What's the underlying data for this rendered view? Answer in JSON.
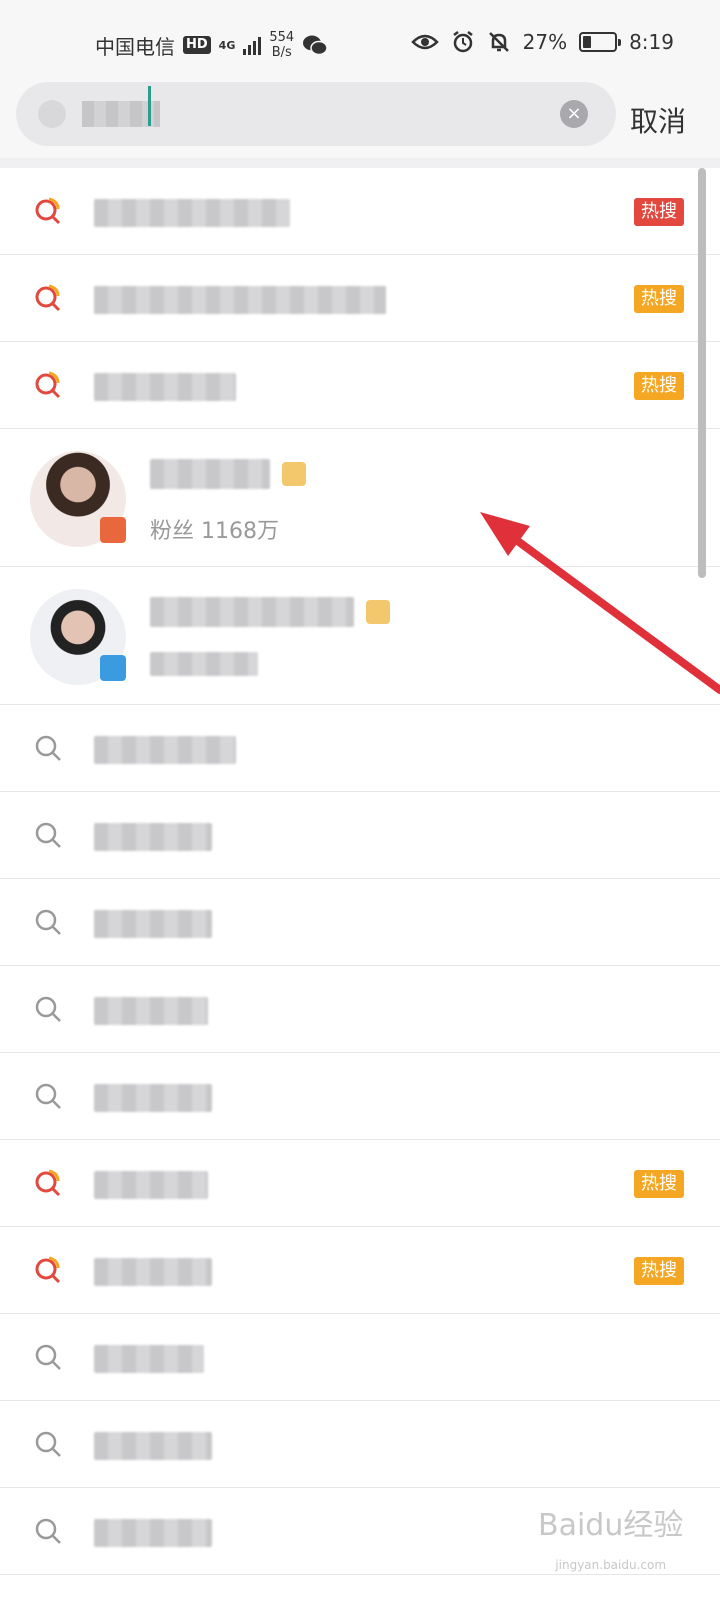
{
  "status_bar": {
    "carrier": "中国电信",
    "hd": "HD",
    "network": "4G",
    "speed_value": "554",
    "speed_unit": "B/s",
    "battery_percent": "27%",
    "battery_level": 0.27,
    "time": "8:19",
    "icons": [
      "wechat-icon",
      "eye-icon",
      "alarm-icon",
      "mute-bell-icon"
    ]
  },
  "search": {
    "cancel_label": "取消",
    "clear_icon": "×"
  },
  "colors": {
    "hot_red": "#e2483d",
    "hot_orange": "#f5a623",
    "caret": "#2a9d8f"
  },
  "rows": [
    {
      "type": "query",
      "icon": "hot-search-icon",
      "badge": "热搜",
      "badge_color": "red"
    },
    {
      "type": "query",
      "icon": "hot-search-icon",
      "badge": "热搜",
      "badge_color": "orange"
    },
    {
      "type": "query",
      "icon": "hot-search-icon",
      "badge": "热搜",
      "badge_color": "orange"
    },
    {
      "type": "user",
      "fans_prefix": "粉丝",
      "fans_count": "1168万"
    },
    {
      "type": "user"
    },
    {
      "type": "query",
      "icon": "search-icon"
    },
    {
      "type": "query",
      "icon": "search-icon"
    },
    {
      "type": "query",
      "icon": "search-icon"
    },
    {
      "type": "query",
      "icon": "search-icon"
    },
    {
      "type": "query",
      "icon": "search-icon"
    },
    {
      "type": "query",
      "icon": "hot-search-icon",
      "badge": "热搜",
      "badge_color": "orange"
    },
    {
      "type": "query",
      "icon": "hot-search-icon",
      "badge": "热搜",
      "badge_color": "orange"
    },
    {
      "type": "query",
      "icon": "search-icon"
    },
    {
      "type": "query",
      "icon": "search-icon"
    },
    {
      "type": "query",
      "icon": "search-icon"
    }
  ],
  "watermark": {
    "text": "Baidu经验",
    "sub": "jingyan.baidu.com"
  }
}
